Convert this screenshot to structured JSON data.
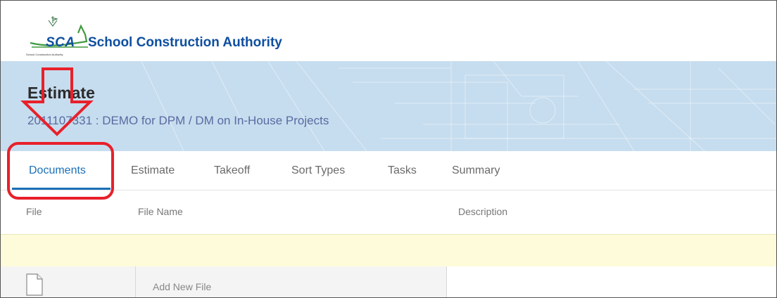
{
  "header": {
    "logo_abbrev": "SCA",
    "logo_name": "School Construction Authority",
    "logo_tagline": "School Construction Authority"
  },
  "page": {
    "title": "Estimate",
    "subtitle": "2011107331 : DEMO for DPM / DM on In-House Projects"
  },
  "tabs": [
    {
      "label": "Documents",
      "active": true
    },
    {
      "label": "Estimate",
      "active": false
    },
    {
      "label": "Takeoff",
      "active": false
    },
    {
      "label": "Sort Types",
      "active": false
    },
    {
      "label": "Tasks",
      "active": false
    },
    {
      "label": "Summary",
      "active": false
    }
  ],
  "table": {
    "columns": [
      "File",
      "File Name",
      "Description"
    ],
    "add_file_label": "Add New File"
  },
  "icons": {
    "file": "file-icon",
    "logo": "sca-logo-icon",
    "arrow": "down-arrow-annotation-icon"
  },
  "colors": {
    "brand": "#0e4fa0",
    "active_tab": "#1b70b8",
    "banner": "#c6ddef",
    "highlight_row": "#fdfbd9",
    "annotation": "#e8202a"
  }
}
